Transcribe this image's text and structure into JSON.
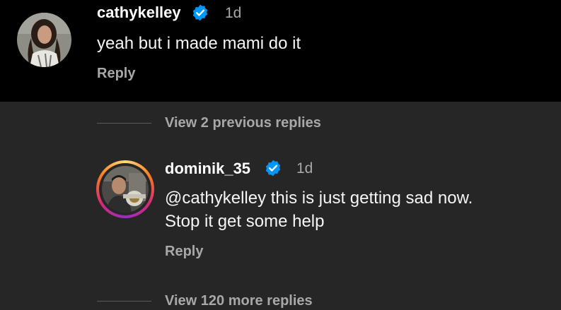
{
  "comments": [
    {
      "username": "cathykelley",
      "verified": true,
      "time": "1d",
      "text_lines": [
        "yeah but i made mami do it"
      ],
      "reply_label": "Reply"
    },
    {
      "username": "dominik_35",
      "verified": true,
      "time": "1d",
      "text_lines": [
        "@cathykelley this is just getting sad now.",
        "Stop it get some help"
      ],
      "reply_label": "Reply"
    }
  ],
  "view_previous_replies": "View 2 previous replies",
  "view_more_replies": "View 120 more replies",
  "colors": {
    "top_background": "#000000",
    "thread_background": "#262626",
    "muted_text": "#a8a8a8",
    "verified_badge": "#0095f6"
  },
  "icons": [
    "verified-badge-icon",
    "story-ring"
  ]
}
